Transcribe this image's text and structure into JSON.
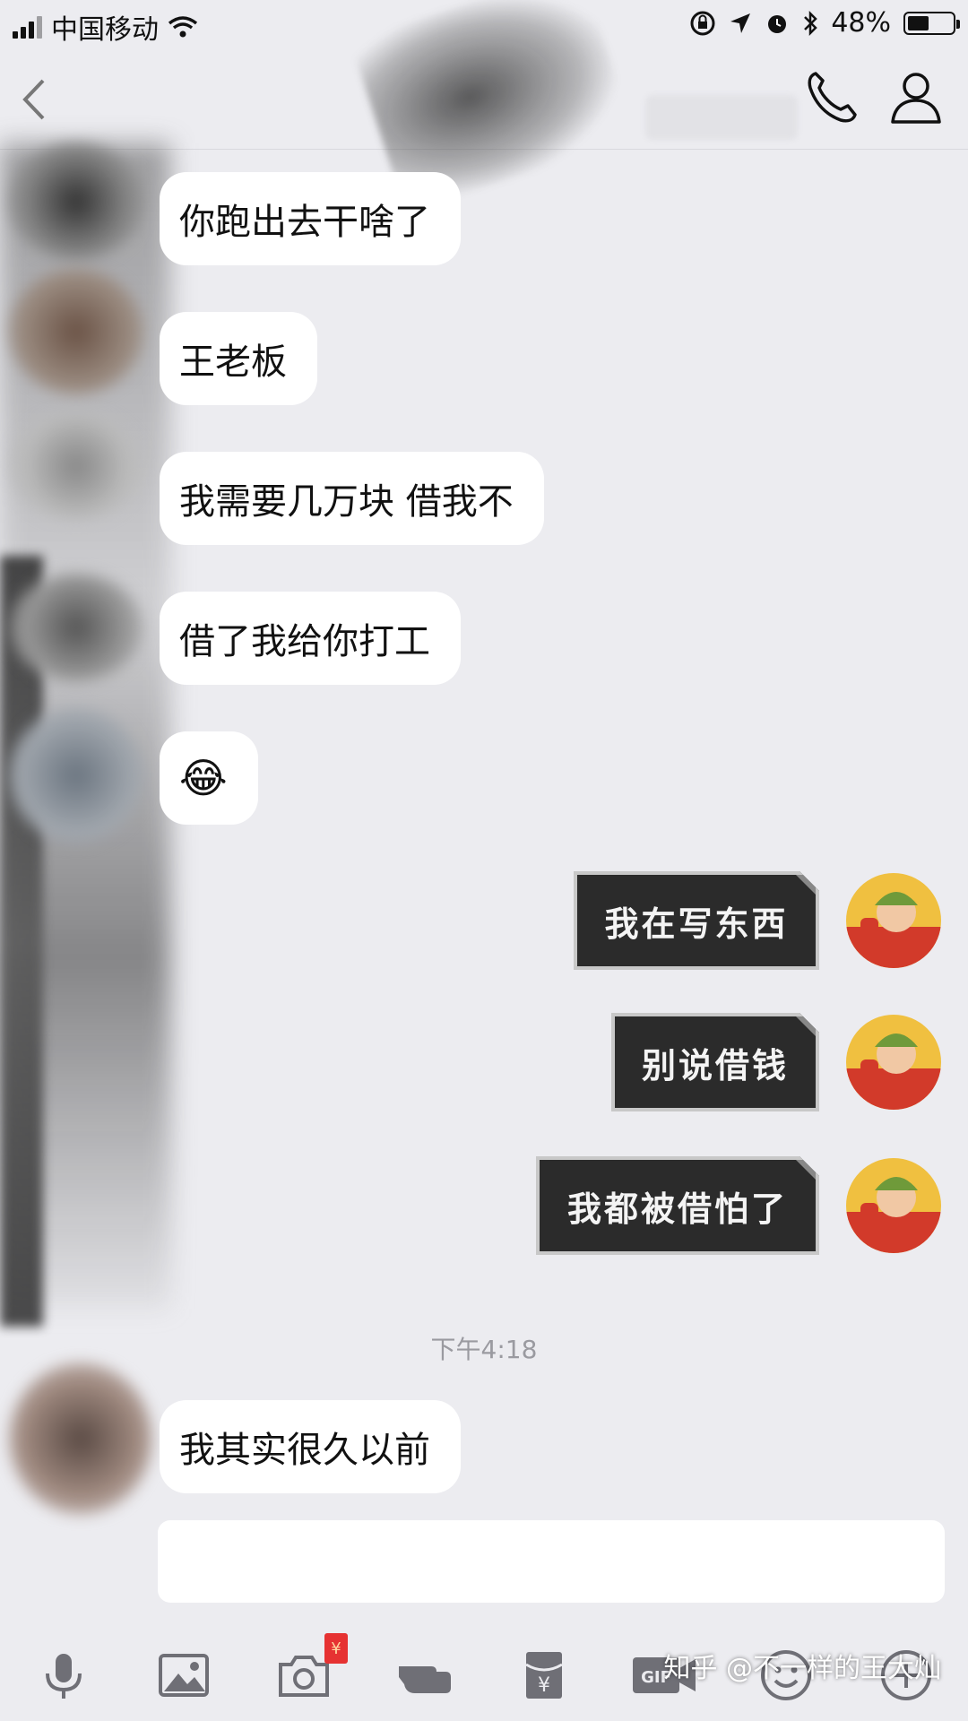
{
  "status_bar": {
    "carrier": "中国移动",
    "battery_percent": "48%",
    "battery_level": 0.48
  },
  "nav": {
    "back_icon": "chevron-left-icon",
    "call_icon": "phone-icon",
    "profile_icon": "person-icon"
  },
  "messages": [
    {
      "side": "in",
      "text": "你跑出去干啥了"
    },
    {
      "side": "in",
      "text": "王老板"
    },
    {
      "side": "in",
      "text": "我需要几万块 借我不"
    },
    {
      "side": "in",
      "text": "借了我给你打工"
    },
    {
      "side": "in",
      "text": "😂"
    },
    {
      "side": "out",
      "text": "我在写东西"
    },
    {
      "side": "out",
      "text": "别说借钱"
    },
    {
      "side": "out",
      "text": "我都被借怕了"
    },
    {
      "side": "in",
      "text": "我其实很久以前"
    }
  ],
  "timestamp": "下午4:18",
  "toolbar": {
    "icons": [
      "microphone-icon",
      "image-icon",
      "camera-icon",
      "poke-icon",
      "red-packet-icon",
      "gif-icon",
      "emoji-icon",
      "plus-icon"
    ],
    "camera_badge": "¥",
    "red_packet_symbol": "¥",
    "gif_label": "GIF"
  },
  "watermark": "知乎 @不一样的王大灿"
}
